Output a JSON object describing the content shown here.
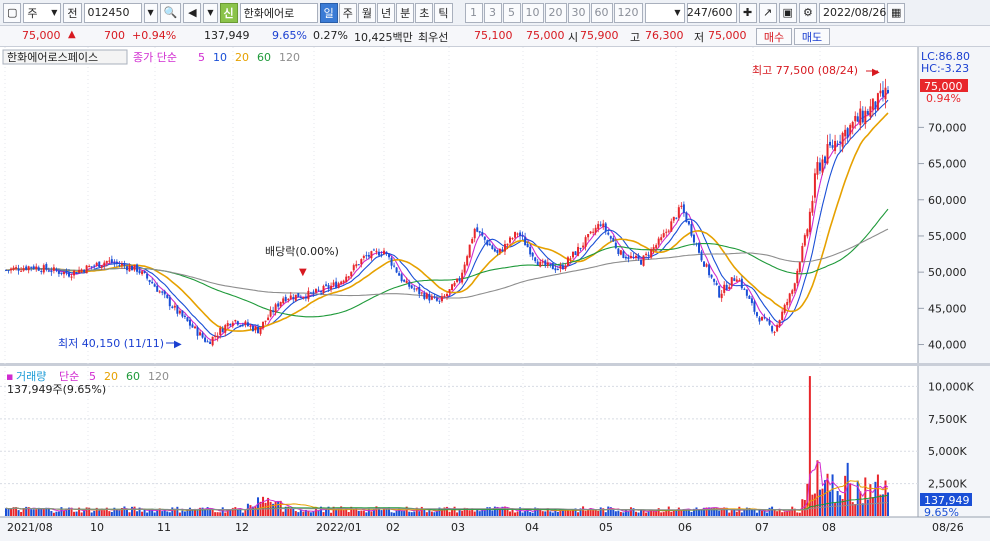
{
  "toolbar": {
    "period_select": "주",
    "prev_label": "전",
    "code": "012450",
    "new_badge": "신",
    "stock_name": "한화에어로",
    "periods": [
      "일",
      "주",
      "월",
      "년",
      "분",
      "초",
      "틱"
    ],
    "active_period": "일",
    "minute_steps": [
      "1",
      "3",
      "5",
      "10",
      "20",
      "30",
      "60",
      "120"
    ],
    "count": "247/600",
    "date": "2022/08/26"
  },
  "quote": {
    "price": "75,000",
    "up_arrow": "▲",
    "change": "700",
    "change_pct": "+0.94%",
    "volume": "137,949",
    "vol_ratio": "9.65%",
    "turnover_pct": "0.27%",
    "amount": "10,425백만",
    "best_ask_label": "최우선",
    "ask": "75,100",
    "bid": "75,000",
    "open_label": "시",
    "open": "75,900",
    "high_label": "고",
    "high": "76,300",
    "low_label": "저",
    "low": "75,000",
    "buy_label": "매수",
    "sell_label": "매도"
  },
  "price_panel": {
    "name_tab": "한화에어로스페이스",
    "legend_prefix": "종가 단순",
    "ma_periods": [
      "5",
      "10",
      "20",
      "60",
      "120"
    ],
    "ma_colors": [
      "#d02bd0",
      "#1a4fd6",
      "#e6a100",
      "#1f9a3a",
      "#8e8e8e"
    ],
    "lc": "LC:86.80",
    "hc": "HC:-3.23",
    "last_price_tag": "75,000",
    "last_change_tag": "0.94%",
    "high_note": "최고 77,500 (08/24)",
    "low_note": "최저 40,150 (11/11)",
    "dividend_note": "배당락(0.00%)",
    "y_ticks": [
      "70,000",
      "65,000",
      "60,000",
      "55,000",
      "50,000",
      "45,000",
      "40,000"
    ]
  },
  "volume_panel": {
    "title": "거래량",
    "legend_prefix": "단순",
    "ma_periods": [
      "5",
      "20",
      "60",
      "120"
    ],
    "ma_colors": [
      "#d02bd0",
      "#e6a100",
      "#1f9a3a",
      "#8e8e8e"
    ],
    "value_text": "137,949주(9.65%)",
    "last_tag": "137,949",
    "last_pct": "9.65%",
    "y_ticks": [
      "10,000K",
      "7,500K",
      "5,000K",
      "2,500K"
    ]
  },
  "x_axis": {
    "labels": [
      "2021/08",
      "10",
      "11",
      "12",
      "2022/01",
      "02",
      "03",
      "04",
      "05",
      "06",
      "07",
      "08"
    ],
    "right_label": "08/26"
  },
  "colors": {
    "up": "#e8262b",
    "down": "#1a4fd6",
    "accent": "#3a7bd5"
  },
  "chart_data": {
    "type": "candlestick",
    "x": [
      "2021-08",
      "2021-09",
      "2021-10",
      "2021-11",
      "2021-12",
      "2022-01",
      "2022-02",
      "2022-03",
      "2022-04",
      "2022-05",
      "2022-06",
      "2022-07",
      "2022-08"
    ],
    "monthly_close": [
      50500,
      51000,
      47000,
      41500,
      46000,
      52500,
      46500,
      55000,
      51000,
      56000,
      50500,
      46000,
      75000
    ],
    "ylim": [
      38000,
      80000
    ],
    "volume_ylim_k": [
      0,
      11500
    ]
  }
}
